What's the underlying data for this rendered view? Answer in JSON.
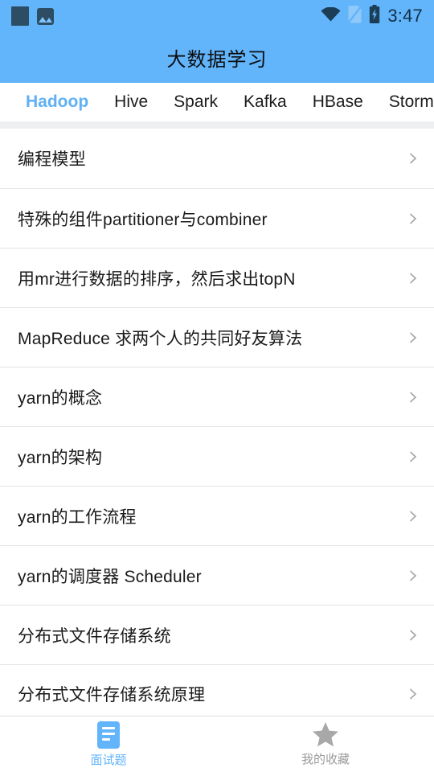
{
  "status_bar": {
    "time": "3:47",
    "left_icons": [
      {
        "name": "notification-square-icon"
      },
      {
        "name": "image-icon"
      }
    ],
    "right_icons": [
      {
        "name": "wifi-icon"
      },
      {
        "name": "sim-card-off-icon"
      },
      {
        "name": "battery-charging-icon"
      }
    ]
  },
  "app_bar": {
    "title": "大数据学习",
    "background": "#62B4FB"
  },
  "tabs": {
    "active_index": 0,
    "active_color": "#5FB0F5",
    "items": [
      {
        "label": "Hadoop"
      },
      {
        "label": "Hive"
      },
      {
        "label": "Spark"
      },
      {
        "label": "Kafka"
      },
      {
        "label": "HBase"
      },
      {
        "label": "Storm"
      }
    ]
  },
  "list": {
    "chevron_icon": "chevron-right-icon",
    "items": [
      {
        "label": "编程模型"
      },
      {
        "label": "特殊的组件partitioner与combiner"
      },
      {
        "label": "用mr进行数据的排序，然后求出topN"
      },
      {
        "label": "MapReduce 求两个人的共同好友算法"
      },
      {
        "label": "yarn的概念"
      },
      {
        "label": "yarn的架构"
      },
      {
        "label": "yarn的工作流程"
      },
      {
        "label": "yarn的调度器 Scheduler"
      },
      {
        "label": "分布式文件存储系统"
      },
      {
        "label": "分布式文件存储系统原理"
      }
    ]
  },
  "bottom_nav": {
    "active_index": 0,
    "active_color": "#62B4FB",
    "inactive_color": "#9B9B9B",
    "items": [
      {
        "label": "面试题",
        "icon": "document-icon"
      },
      {
        "label": "我的收藏",
        "icon": "star-icon"
      }
    ]
  }
}
